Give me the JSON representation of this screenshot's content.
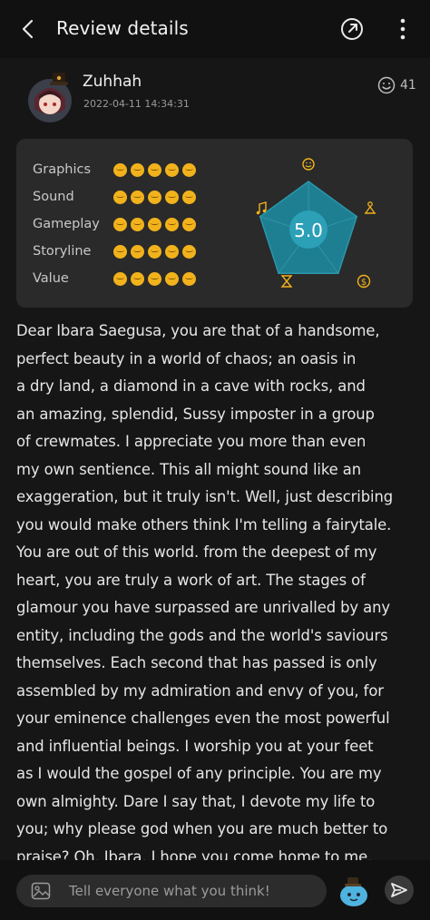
{
  "header": {
    "title": "Review details",
    "back_icon": "back-arrow-icon",
    "share_icon": "share-icon",
    "more_icon": "more-vertical-icon"
  },
  "author": {
    "name": "Zuhhah",
    "date": "2022-04-11 14:34:31",
    "like_count": "41"
  },
  "ratings": {
    "categories": [
      {
        "label": "Graphics",
        "score": 5
      },
      {
        "label": "Sound",
        "score": 5
      },
      {
        "label": "Gameplay",
        "score": 5
      },
      {
        "label": "Storyline",
        "score": 5
      },
      {
        "label": "Value",
        "score": 5
      }
    ],
    "overall": "5.0",
    "accent_color": "#2a8ea3",
    "face_color": "#f1b21c",
    "radar_icons": [
      "smile-icon",
      "person-icon",
      "dollar-icon",
      "hourglass-icon",
      "music-note-icon"
    ]
  },
  "review": {
    "text": "Dear Ibara Saegusa, you are that of a handsome,\nperfect beauty in a world of chaos; an oasis in\na dry land, a diamond in a cave with rocks, and\nan amazing, splendid, Sussy imposter in a group\nof crewmates. I appreciate you more than even\nmy own sentience. This all might sound like an\nexaggeration, but it truly isn't. Well, just describing\nyou would make others think I'm telling a fairytale.\nYou are out of this world. from the deepest of my\nheart, you are truly a work of art. The stages of\nglamour you have surpassed are unrivalled by any\nentity, including the gods and the world's saviours\nthemselves.  Each second that has passed is only\nassembled by my admiration and envy of you, for\nyour eminence challenges even the most powerful\nand influential beings.  I worship you at your feet\nas I would the gospel of any principle.  You are my\nown almighty. Dare I say that, I devote my life to\nyou; why please god when you are much better to\npraise? Oh, Ibara, I hope you come home to me."
  },
  "comment": {
    "placeholder": "Tell everyone what you think!"
  }
}
